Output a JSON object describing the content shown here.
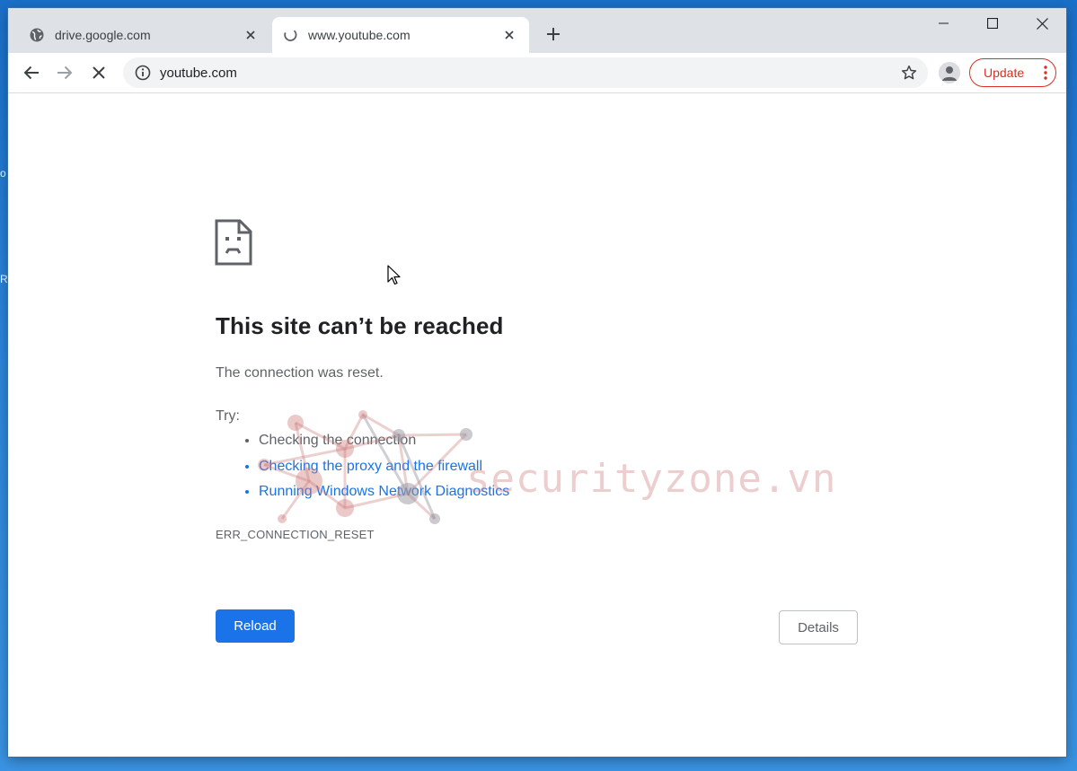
{
  "browser": {
    "tabs": [
      {
        "title": "drive.google.com",
        "icon": "globe-icon",
        "active": false
      },
      {
        "title": "www.youtube.com",
        "icon": "loading-spinner-icon",
        "active": true
      }
    ],
    "address": "youtube.com",
    "update_label": "Update",
    "colors": {
      "accent": "#1a73e8",
      "update": "#d93025",
      "tab_strip": "#dee1e6"
    }
  },
  "page": {
    "heading": "This site can’t be reached",
    "subtext": "The connection was reset.",
    "try_label": "Try:",
    "suggestions": [
      {
        "text": "Checking the connection",
        "link": false
      },
      {
        "text": "Checking the proxy and the firewall",
        "link": true
      },
      {
        "text": "Running Windows Network Diagnostics",
        "link": true
      }
    ],
    "error_code": "ERR_CONNECTION_RESET",
    "reload_label": "Reload",
    "details_label": "Details"
  },
  "watermark": {
    "text": "securityzone.vn"
  },
  "desktop": {
    "glyph_1": "o",
    "glyph_2": "R"
  }
}
